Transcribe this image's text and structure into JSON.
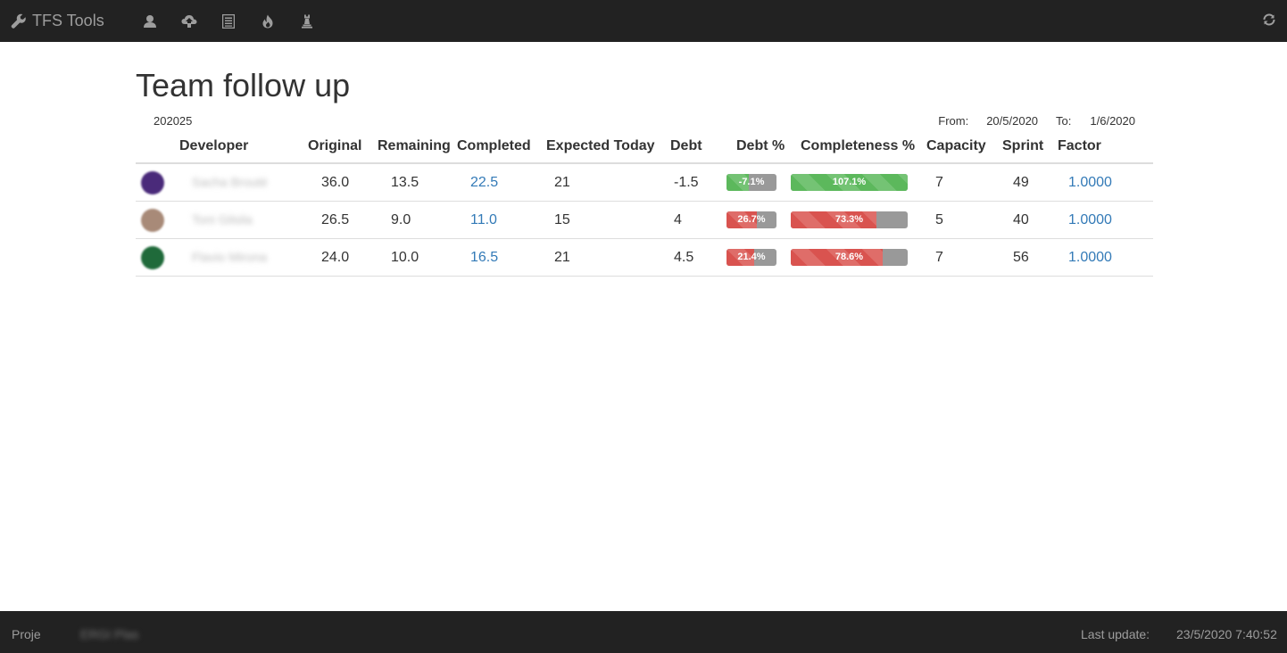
{
  "navbar": {
    "brand": "TFS Tools",
    "brand_icon": "wrench-icon",
    "icons": [
      "user-icon",
      "cloud-upload-icon",
      "list-alt-icon",
      "fire-icon",
      "tower-icon"
    ],
    "refresh_icon": "refresh-icon"
  },
  "page": {
    "title": "Team follow up",
    "sprint": "202025",
    "from_label": "From:",
    "from_value": "20/5/2020",
    "to_label": "To:",
    "to_value": "1/6/2020"
  },
  "table": {
    "headers": {
      "developer": "Developer",
      "original": "Original",
      "remaining": "Remaining",
      "completed": "Completed",
      "expected": "Expected Today",
      "debt": "Debt",
      "debt_pct": "Debt %",
      "completeness": "Completeness %",
      "capacity": "Capacity",
      "sprint": "Sprint",
      "factor": "Factor"
    },
    "rows": [
      {
        "avatar_color": "#4a2a7a",
        "name": "Sacha Brouté",
        "original": "36.0",
        "remaining": "13.5",
        "completed": "22.5",
        "expected": "21",
        "debt": "-1.5",
        "debt_pct_label": "-7.1%",
        "debt_pct_fill": 0.45,
        "debt_color": "green",
        "completeness_label": "107.1%",
        "completeness_fill": 1.0,
        "completeness_color": "green",
        "capacity": "7",
        "sprint": "49",
        "factor": "1.0000"
      },
      {
        "avatar_color": "#a88a78",
        "name": "Toni Gilsila",
        "original": "26.5",
        "remaining": "9.0",
        "completed": "11.0",
        "expected": "15",
        "debt": "4",
        "debt_pct_label": "26.7%",
        "debt_pct_fill": 0.6,
        "debt_color": "red",
        "completeness_label": "73.3%",
        "completeness_fill": 0.733,
        "completeness_color": "red",
        "capacity": "5",
        "sprint": "40",
        "factor": "1.0000"
      },
      {
        "avatar_color": "#1f6a3a",
        "name": "Flavio Mirona",
        "original": "24.0",
        "remaining": "10.0",
        "completed": "16.5",
        "expected": "21",
        "debt": "4.5",
        "debt_pct_label": "21.4%",
        "debt_pct_fill": 0.55,
        "debt_color": "red",
        "completeness_label": "78.6%",
        "completeness_fill": 0.786,
        "completeness_color": "red",
        "capacity": "7",
        "sprint": "56",
        "factor": "1.0000"
      }
    ]
  },
  "footer": {
    "project_label": "Proje",
    "project_value": "ERGI Plas",
    "last_update_label": "Last update:",
    "last_update_value": "23/5/2020 7:40:52"
  }
}
